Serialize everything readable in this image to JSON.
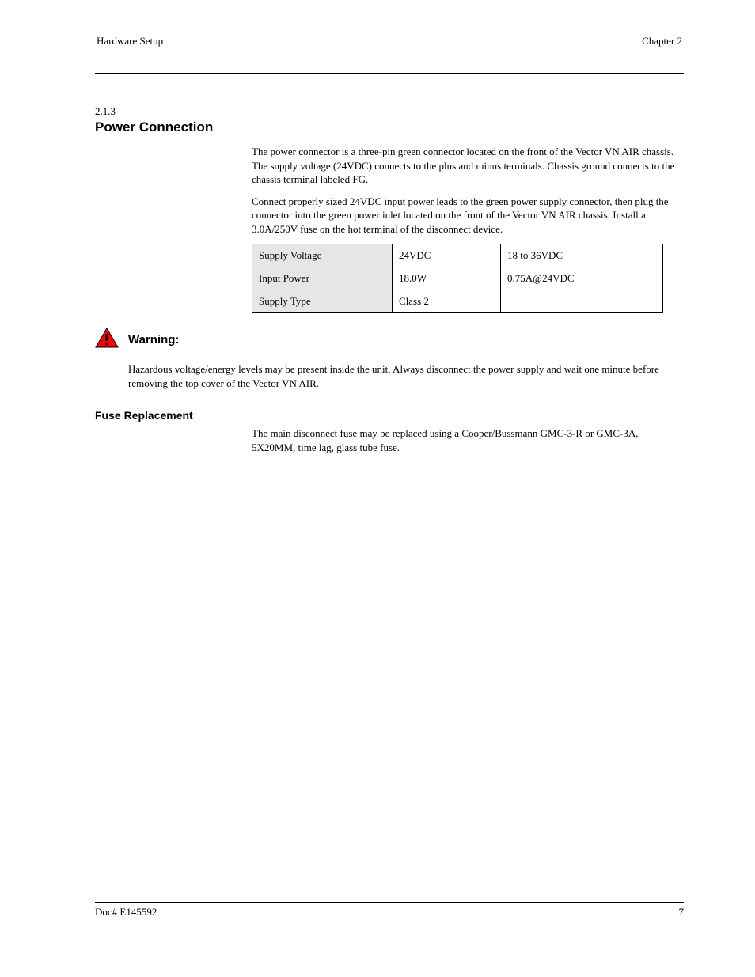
{
  "header": {
    "left": "Hardware Setup",
    "right": "Chapter 2"
  },
  "section": {
    "number": "2.1.3",
    "title": "Power Connection"
  },
  "p1": "The power connector is a three-pin green connector located on the front of the Vector VN AIR chassis. The supply voltage (24VDC) connects to the plus and minus terminals. Chassis ground connects to the chassis terminal labeled FG.",
  "p2": "Connect properly sized 24VDC input power leads to the green power supply connector, then plug the connector into the green power inlet located on the front of the Vector VN AIR chassis. Install a 3.0A/250V fuse on the hot terminal of the disconnect device.",
  "table": {
    "rows": [
      {
        "label": "Supply Voltage",
        "mid": "24VDC",
        "right": "18 to 36VDC"
      },
      {
        "label": "Input Power",
        "mid": "18.0W",
        "right": "0.75A@24VDC"
      },
      {
        "label": "Supply Type",
        "mid": "Class 2",
        "right": ""
      }
    ]
  },
  "warning": {
    "label": "Warning:",
    "text": "Hazardous voltage/energy levels may be present inside the unit. Always disconnect the power supply and wait one minute before removing the top cover of the Vector VN AIR."
  },
  "fuse": {
    "title": "Fuse Replacement",
    "text": "The main disconnect fuse may be replaced using a Cooper/Bussmann GMC-3-R or GMC-3A, 5X20MM, time lag, glass tube fuse."
  },
  "footer": {
    "left": "Doc# E145592",
    "right": "7"
  }
}
